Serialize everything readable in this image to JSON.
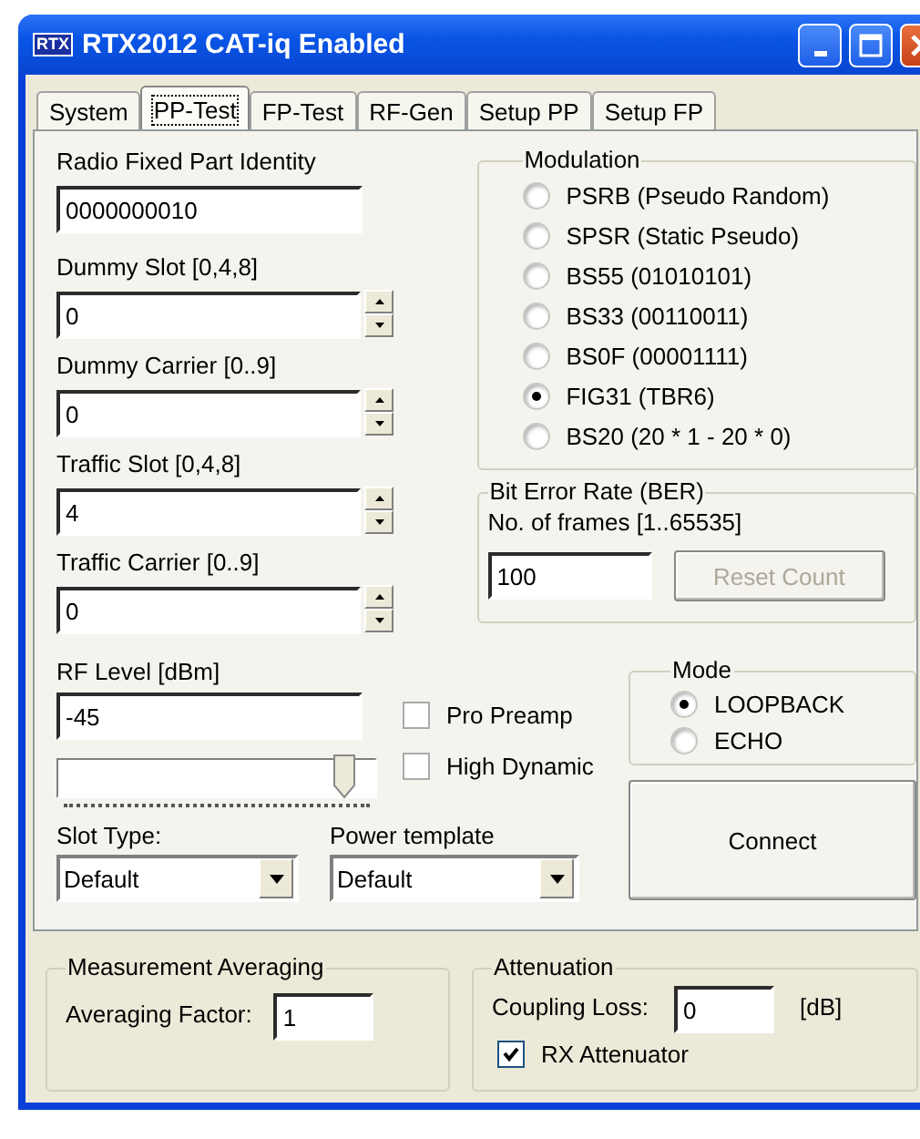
{
  "window": {
    "title": "RTX2012 CAT-iq Enabled",
    "icon_text": "RTX"
  },
  "tabs": [
    {
      "label": "System",
      "selected": false
    },
    {
      "label": "PP-Test",
      "selected": true
    },
    {
      "label": "FP-Test",
      "selected": false
    },
    {
      "label": "RF-Gen",
      "selected": false
    },
    {
      "label": "Setup PP",
      "selected": false
    },
    {
      "label": "Setup FP",
      "selected": false
    }
  ],
  "fields": [
    {
      "label": "Radio Fixed Part Identity",
      "value": "0000000010",
      "kind": "text"
    },
    {
      "label": "Dummy Slot [0,4,8]",
      "value": "0",
      "kind": "spin"
    },
    {
      "label": "Dummy Carrier [0..9]",
      "value": "0",
      "kind": "spin"
    },
    {
      "label": "Traffic Slot [0,4,8]",
      "value": "4",
      "kind": "spin"
    },
    {
      "label": "Traffic Carrier [0..9]",
      "value": "0",
      "kind": "spin"
    }
  ],
  "modulation": {
    "title": "Modulation",
    "options": [
      {
        "label": "PSRB (Pseudo Random)",
        "selected": false
      },
      {
        "label": "SPSR (Static Pseudo)",
        "selected": false
      },
      {
        "label": "BS55 (01010101)",
        "selected": false
      },
      {
        "label": "BS33 (00110011)",
        "selected": false
      },
      {
        "label": "BS0F (00001111)",
        "selected": false
      },
      {
        "label": "FIG31 (TBR6)",
        "selected": true
      },
      {
        "label": "BS20 (20 * 1 - 20 * 0)",
        "selected": false
      }
    ]
  },
  "ber": {
    "title": "Bit Error Rate (BER)",
    "frames_label": "No. of frames [1..65535]",
    "frames": "100",
    "reset_button": {
      "label": "Reset Count",
      "disabled": true
    }
  },
  "rf_level": {
    "label": "RF Level [dBm]",
    "value": "-45",
    "level": 0.9
  },
  "checkboxes": [
    {
      "label": "Pro Preamp",
      "checked": false
    },
    {
      "label": "High Dynamic",
      "checked": false
    }
  ],
  "mode": {
    "title": "Mode",
    "options": [
      {
        "label": "LOOPBACK",
        "selected": true
      },
      {
        "label": "ECHO",
        "selected": false
      }
    ]
  },
  "connect_button": "Connect",
  "dropdowns": [
    {
      "label": "Slot Type:",
      "value": "Default"
    },
    {
      "label": "Power template",
      "value": "Default"
    }
  ],
  "averaging": {
    "title": "Measurement Averaging",
    "label": "Averaging Factor:",
    "value": "1"
  },
  "attenuation": {
    "title": "Attenuation",
    "label": "Coupling Loss:",
    "value": "0",
    "unit": "[dB]",
    "rx_attenuator": {
      "label": "RX Attenuator",
      "checked": true
    }
  }
}
